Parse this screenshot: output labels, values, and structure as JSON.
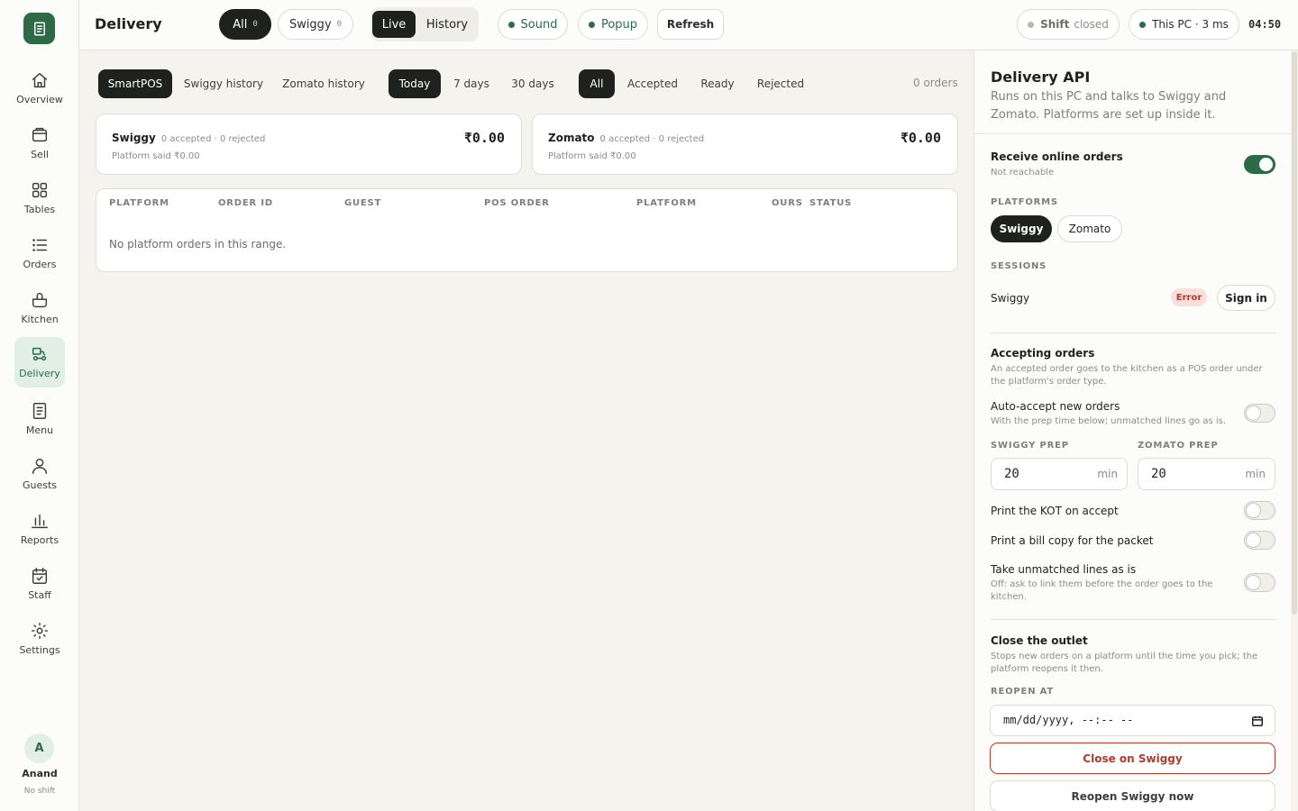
{
  "sidebar": {
    "items": [
      {
        "label": "Overview",
        "icon": "home-icon"
      },
      {
        "label": "Sell",
        "icon": "register-icon"
      },
      {
        "label": "Tables",
        "icon": "grid-icon"
      },
      {
        "label": "Orders",
        "icon": "list-icon"
      },
      {
        "label": "Kitchen",
        "icon": "pot-icon"
      },
      {
        "label": "Delivery",
        "icon": "scooter-icon"
      },
      {
        "label": "Menu",
        "icon": "menu-doc-icon"
      },
      {
        "label": "Guests",
        "icon": "person-icon"
      },
      {
        "label": "Reports",
        "icon": "bar-chart-icon"
      },
      {
        "label": "Staff",
        "icon": "calendar-icon"
      },
      {
        "label": "Settings",
        "icon": "gear-icon"
      }
    ],
    "active": "Delivery",
    "user": {
      "initial": "A",
      "name": "Anand",
      "status": "No shift"
    }
  },
  "header": {
    "title": "Delivery",
    "filters": [
      {
        "label": "All",
        "count": "0"
      },
      {
        "label": "Swiggy",
        "count": "0"
      }
    ],
    "mode": {
      "live": "Live",
      "history": "History"
    },
    "sound": "Sound",
    "popup": "Popup",
    "refresh": "Refresh",
    "shift_label": "Shift",
    "shift_status": "closed",
    "device": "This PC · 3 ms",
    "clock": "04:50"
  },
  "main": {
    "source_tabs": [
      "SmartPOS",
      "Swiggy history",
      "Zomato history"
    ],
    "range_tabs": [
      "Today",
      "7 days",
      "30 days"
    ],
    "status_tabs": [
      "All",
      "Accepted",
      "Ready",
      "Rejected"
    ],
    "order_count": "0 orders",
    "cards": [
      {
        "name": "Swiggy",
        "meta": "0 accepted · 0 rejected",
        "amount": "₹0.00",
        "said": "Platform said ₹0.00"
      },
      {
        "name": "Zomato",
        "meta": "0 accepted · 0 rejected",
        "amount": "₹0.00",
        "said": "Platform said ₹0.00"
      }
    ],
    "columns": [
      "PLATFORM",
      "ORDER ID",
      "GUEST",
      "POS ORDER",
      "PLATFORM",
      "OURS",
      "STATUS"
    ],
    "empty_text": "No platform orders in this range."
  },
  "panel": {
    "title": "Delivery API",
    "subtitle": "Runs on this PC and talks to Swiggy and Zomato. Platforms are set up inside it.",
    "receive_label": "Receive online orders",
    "receive_sub": "Not reachable",
    "receive_on": true,
    "platforms_caption": "PLATFORMS",
    "platforms": [
      "Swiggy",
      "Zomato"
    ],
    "sessions_caption": "SESSIONS",
    "session_name": "Swiggy",
    "session_badge": "Error",
    "sign_in": "Sign in",
    "accepting_title": "Accepting orders",
    "accepting_sub": "An accepted order goes to the kitchen as a POS order under the platform's order type.",
    "auto_accept_label": "Auto-accept new orders",
    "auto_accept_sub": "With the prep time below; unmatched lines go as is.",
    "swiggy_prep_caption": "SWIGGY PREP",
    "zomato_prep_caption": "ZOMATO PREP",
    "swiggy_prep": "20",
    "zomato_prep": "20",
    "unit": "min",
    "print_kot": "Print the KOT on accept",
    "print_bill": "Print a bill copy for the packet",
    "unmatched_label": "Take unmatched lines as is",
    "unmatched_sub": "Off: ask to link them before the order goes to the kitchen.",
    "close_title": "Close the outlet",
    "close_sub": "Stops new orders on a platform until the time you pick; the platform reopens it then.",
    "reopen_caption": "REOPEN AT",
    "reopen_placeholder": "mm/dd/yyyy, --:-- --",
    "close_button": "Close on Swiggy",
    "reopen_button": "Reopen Swiggy now"
  },
  "colors": {
    "accent": "#2c6a48",
    "danger": "#b23a2e",
    "ink": "#1f211f"
  }
}
